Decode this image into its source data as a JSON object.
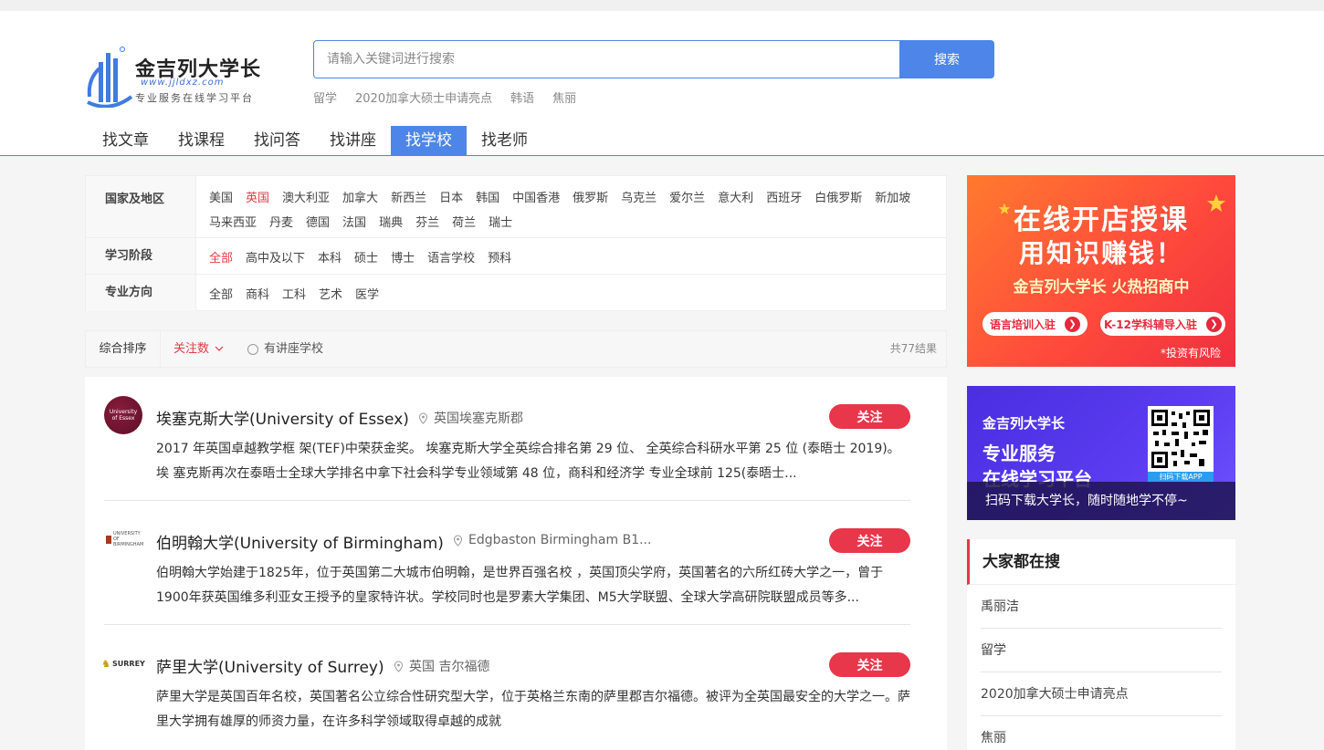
{
  "brand": {
    "name": "金吉列大学长",
    "url": "www.jjldxz.com",
    "slogan": "专业服务在线学习平台",
    "primary_color": "#4d86e8",
    "accent_color": "#e8364a"
  },
  "search": {
    "placeholder": "请输入关键词进行搜索",
    "button_label": "搜索",
    "hot_keywords": [
      "留学",
      "2020加拿大硕士申请亮点",
      "韩语",
      "焦丽"
    ]
  },
  "nav": {
    "tabs": [
      {
        "label": "找文章",
        "active": false
      },
      {
        "label": "找课程",
        "active": false
      },
      {
        "label": "找问答",
        "active": false
      },
      {
        "label": "找讲座",
        "active": false
      },
      {
        "label": "找学校",
        "active": true
      },
      {
        "label": "找老师",
        "active": false
      }
    ]
  },
  "filters": [
    {
      "label": "国家及地区",
      "options": [
        "美国",
        "英国",
        "澳大利亚",
        "加拿大",
        "新西兰",
        "日本",
        "韩国",
        "中国香港",
        "俄罗斯",
        "乌克兰",
        "爱尔兰",
        "意大利",
        "西班牙",
        "白俄罗斯",
        "新加坡",
        "马来西亚",
        "丹麦",
        "德国",
        "法国",
        "瑞典",
        "芬兰",
        "荷兰",
        "瑞士"
      ],
      "selected": "英国"
    },
    {
      "label": "学习阶段",
      "options": [
        "全部",
        "高中及以下",
        "本科",
        "硕士",
        "博士",
        "语言学校",
        "预科"
      ],
      "selected": "全部"
    },
    {
      "label": "专业方向",
      "options": [
        "全部",
        "商科",
        "工科",
        "艺术",
        "医学"
      ],
      "selected": ""
    }
  ],
  "sort": {
    "comprehensive": "综合排序",
    "followers": "关注数",
    "has_lecture": "有讲座学校",
    "result_count": "共77结果"
  },
  "schools": [
    {
      "name": "埃塞克斯大学(University of Essex)",
      "location": "英国埃塞克斯郡",
      "logo_text": "University of Essex",
      "follow_label": "关注",
      "description": "2017 年英国卓越教学框 架(TEF)中荣获金奖。 埃塞克斯大学全英综合排名第 29 位、 全英综合科研水平第 25 位 (泰晤士 2019)。埃 塞克斯再次在泰晤士全球大学排名中拿下社会科学专业领域第 48 位，商科和经济学 专业全球前 125(泰晤士..."
    },
    {
      "name": "伯明翰大学(University of Birmingham)",
      "location": "Edgbaston Birmingham B1...",
      "logo_text": "UNIVERSITY OF BIRMINGHAM",
      "follow_label": "关注",
      "description": "伯明翰大学始建于1825年，位于英国第二大城市伯明翰，是世界百强名校 ，英国顶尖学府，英国著名的六所红砖大学之一，曾于1900年获英国维多利亚女王授予的皇家特许状。学校同时也是罗素大学集团、M5大学联盟、全球大学高研院联盟成员等多..."
    },
    {
      "name": "萨里大学(University of Surrey)",
      "location": "英国 吉尔福德",
      "logo_text": "SURREY",
      "follow_label": "关注",
      "description": "萨里大学是英国百年名校，英国著名公立综合性研究型大学，位于英格兰东南的萨里郡吉尔福德。被评为全英国最安全的大学之一。萨里大学拥有雄厚的师资力量，在许多科学领域取得卓越的成就"
    }
  ],
  "ads": {
    "ad1": {
      "line1": "在线开店授课",
      "line2": "用知识赚钱！",
      "line3": "金吉列大学长 火热招商中",
      "pill1": "语言培训入驻",
      "pill2": "K-12学科辅导入驻",
      "note": "*投资有风险"
    },
    "ad2": {
      "line1": "金吉列大学长",
      "line2": "专业服务",
      "line3": "在线学习平台",
      "scan": "扫码下载APP",
      "caption": "扫码下载大学长，随时随地学不停~"
    }
  },
  "hot_search": {
    "title": "大家都在搜",
    "items": [
      "禹丽洁",
      "留学",
      "2020加拿大硕士申请亮点",
      "焦丽"
    ]
  }
}
